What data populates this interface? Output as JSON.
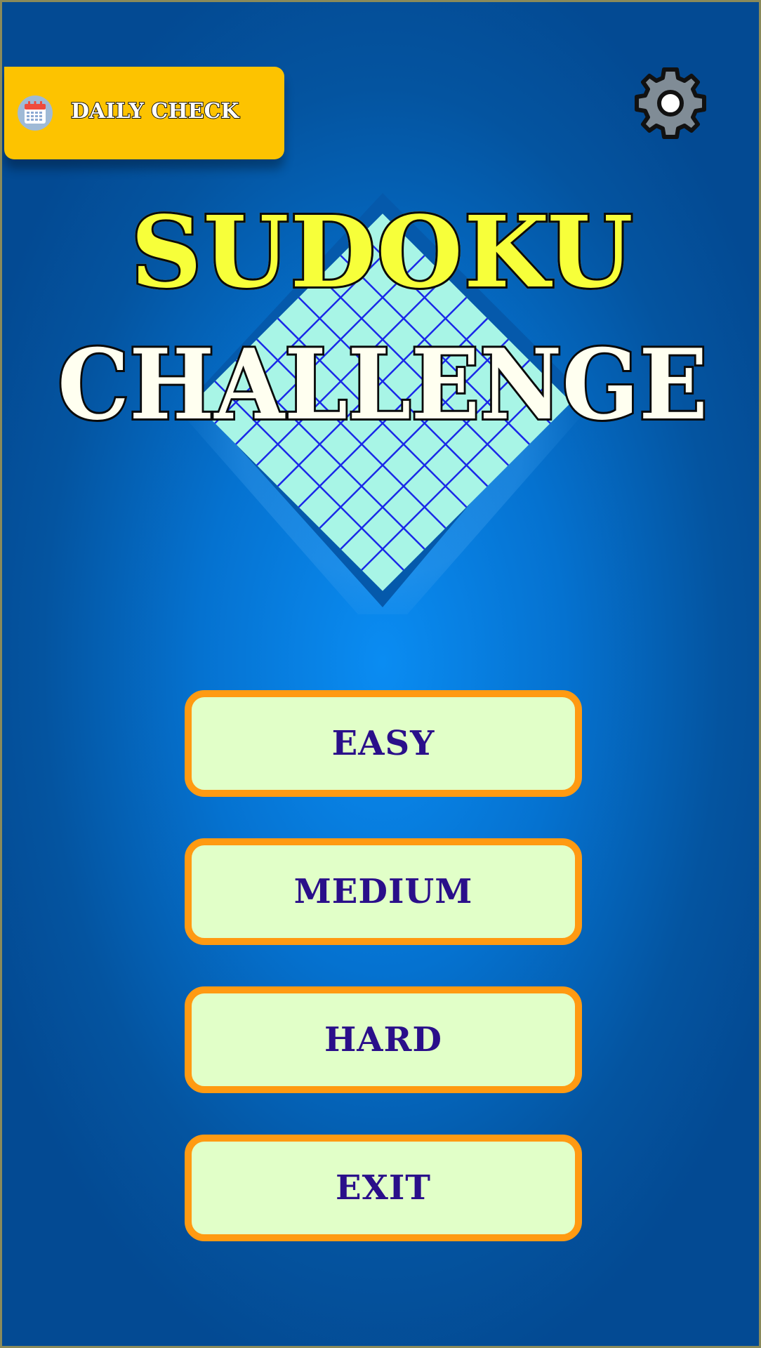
{
  "header": {
    "daily_check_label": "DAILY CHECK",
    "daily_check_icon": "calendar-icon",
    "settings_icon": "gear-icon"
  },
  "title": {
    "line1": "SUDOKU",
    "line2": "CHALLENGE"
  },
  "menu": {
    "easy": "EASY",
    "medium": "MEDIUM",
    "hard": "HARD",
    "exit": "EXIT"
  },
  "colors": {
    "background": "#0572d0",
    "daily_check_bg": "#fdc300",
    "title_line1": "#f7ff3a",
    "title_line2": "#fffff0",
    "button_bg": "#e1ffc8",
    "button_border": "#ff9a12",
    "button_text": "#2a0f8a",
    "board_fill": "#a8f5e6",
    "board_lines": "#1a28e8",
    "board_border": "#0559ab",
    "gear_fill": "#808c96"
  }
}
